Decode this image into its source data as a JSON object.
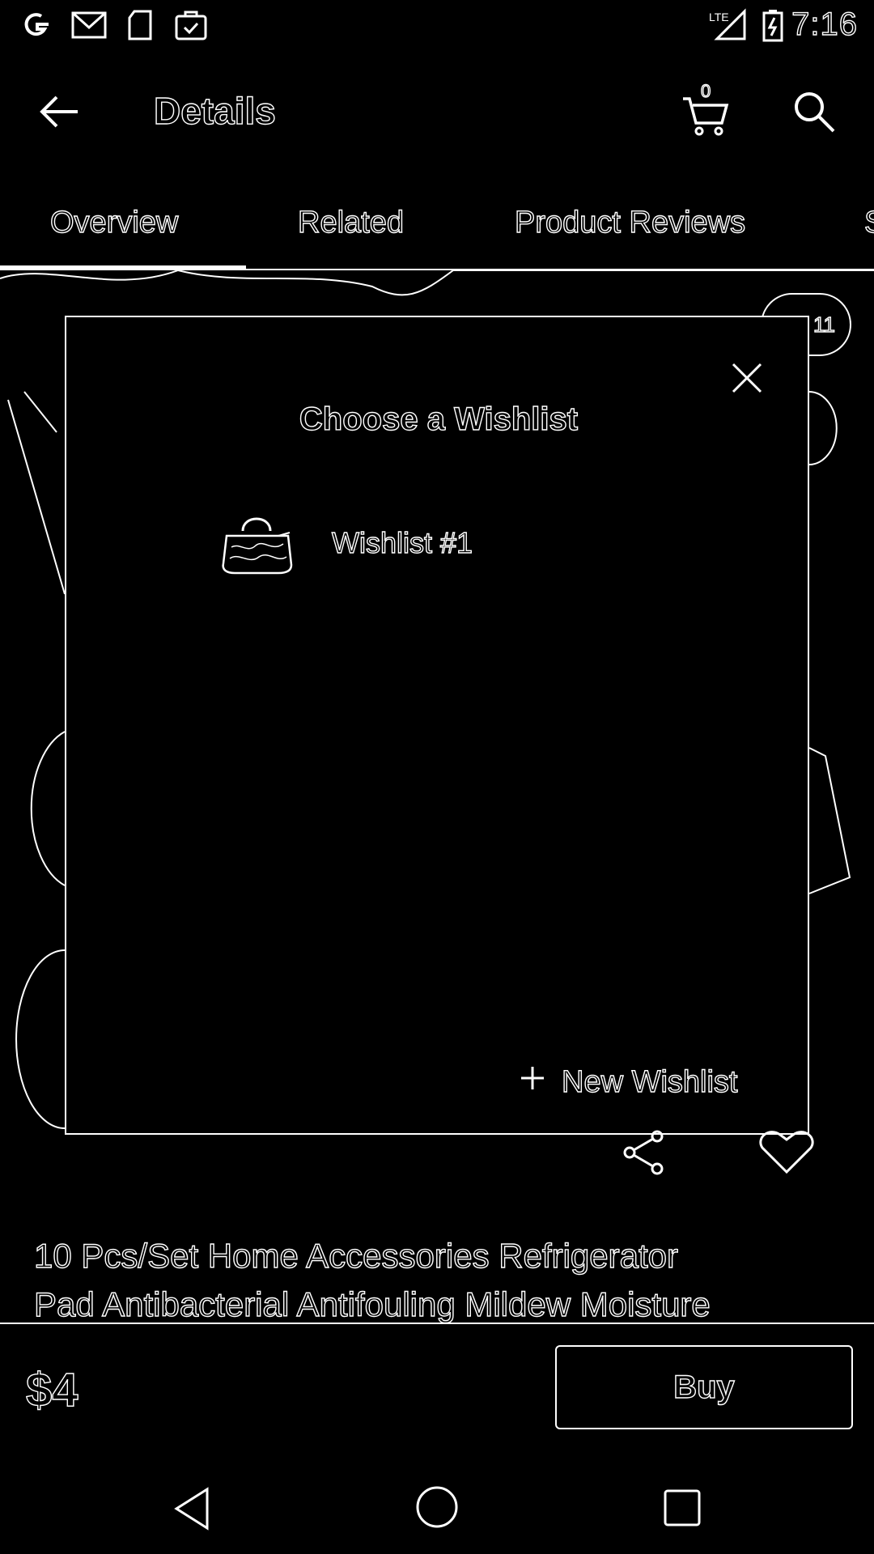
{
  "status_bar": {
    "time": "7:16",
    "network": "LTE",
    "left_icons": [
      "google-icon",
      "gmail-icon",
      "sd-card-icon",
      "briefcase-check-icon"
    ],
    "right_icons": [
      "lte-signal-icon",
      "battery-charging-icon"
    ]
  },
  "app_bar": {
    "title": "Details",
    "cart_count": "0",
    "icons": [
      "back-arrow-icon",
      "cart-icon",
      "search-icon"
    ]
  },
  "tabs": [
    {
      "label": "Overview",
      "active": true
    },
    {
      "label": "Related",
      "active": false
    },
    {
      "label": "Product Reviews",
      "active": false
    },
    {
      "label": "S",
      "active": false
    }
  ],
  "gallery": {
    "badge_count": "11"
  },
  "modal": {
    "title": "Choose a Wishlist",
    "wishlists": [
      {
        "name": "Wishlist #1",
        "thumbnail": "bag-thumbnail"
      }
    ],
    "new_wishlist_label": "New Wishlist",
    "new_wishlist_icon": "plus-icon",
    "close_icon": "close-icon"
  },
  "product": {
    "title_line1": "10 Pcs/Set Home Accessories Refrigerator",
    "title_line2": "Pad Antibacterial Antifouling Mildew Moisture",
    "price": "$4",
    "buy_label": "Buy",
    "share_icon": "share-icon",
    "favorite_icon": "heart-icon"
  },
  "nav_bar": {
    "icons": [
      "nav-back-icon",
      "nav-home-icon",
      "nav-recents-icon"
    ]
  },
  "colors": {
    "background": "#000000",
    "foreground": "#ffffff"
  }
}
